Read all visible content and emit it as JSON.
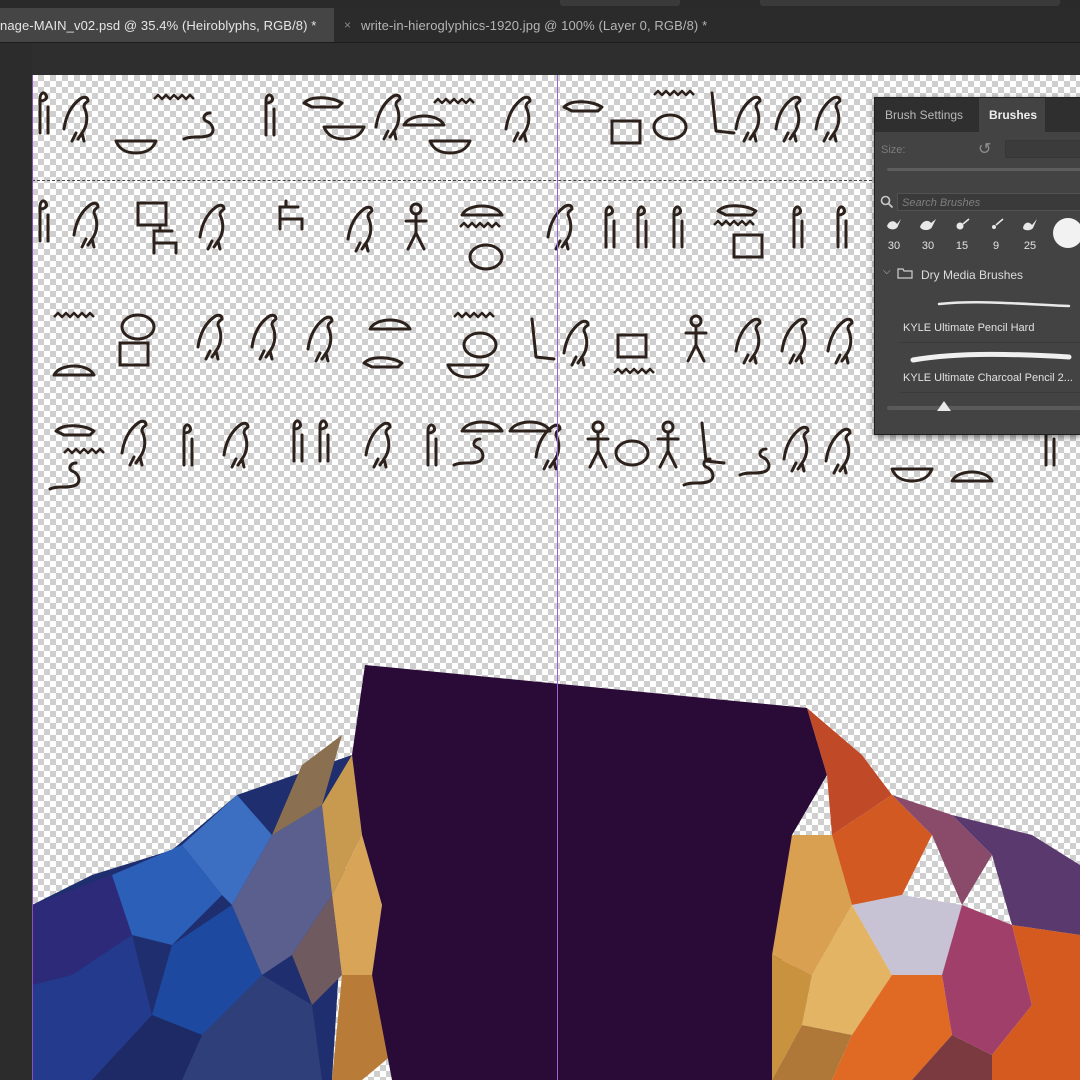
{
  "app": {
    "tabs": [
      {
        "label": "nage-MAIN_v02.psd @ 35.4% (Heiroblyphs, RGB/8) *",
        "active": true,
        "close_glyph": ""
      },
      {
        "label": "write-in-hieroglyphics-1920.jpg @ 100% (Layer 0, RGB/8) *",
        "active": false,
        "close_glyph": "×"
      }
    ]
  },
  "panel": {
    "tabs": [
      {
        "label": "Brush Settings",
        "active": false
      },
      {
        "label": "Brushes",
        "active": true
      }
    ],
    "size_label": "Size:",
    "search_placeholder": "Search Brushes",
    "presets": [
      "30",
      "30",
      "15",
      "9",
      "25"
    ],
    "group_label": "Dry Media Brushes",
    "brushes": [
      {
        "name": "KYLE Ultimate Pencil Hard"
      },
      {
        "name": "KYLE Ultimate Charcoal Pencil 2..."
      }
    ]
  },
  "colors": {
    "canvas_dark_purple": "#2a0a36",
    "guide": "#9c63d6",
    "glyph_ink": "#2d211c",
    "panel_bg": "#434343"
  },
  "icons": {
    "reset": "reset-icon",
    "search": "search-icon",
    "folder": "folder-icon",
    "chevron": "chevron-down-icon"
  }
}
